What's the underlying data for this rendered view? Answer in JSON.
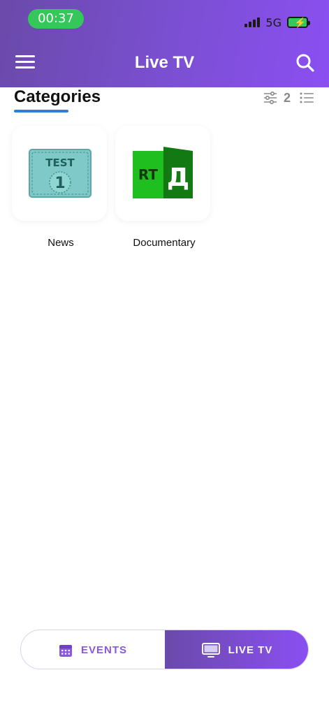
{
  "status_bar": {
    "time": "00:37",
    "network": "5G"
  },
  "header": {
    "title": "Live TV"
  },
  "categories": {
    "title": "Categories",
    "count": "2",
    "accent_color": "#2f7de1",
    "items": [
      {
        "label": "News",
        "logo_text": "TEST",
        "logo_number": "1",
        "icon": "test1-channel-logo"
      },
      {
        "label": "Documentary",
        "logo_text": "RT",
        "logo_letter": "Д",
        "icon": "rtd-channel-logo"
      }
    ]
  },
  "tabbar": {
    "events_label": "EVENTS",
    "live_label": "LIVE TV",
    "active": "LIVE TV",
    "accent_color": "#8b4ff2"
  }
}
